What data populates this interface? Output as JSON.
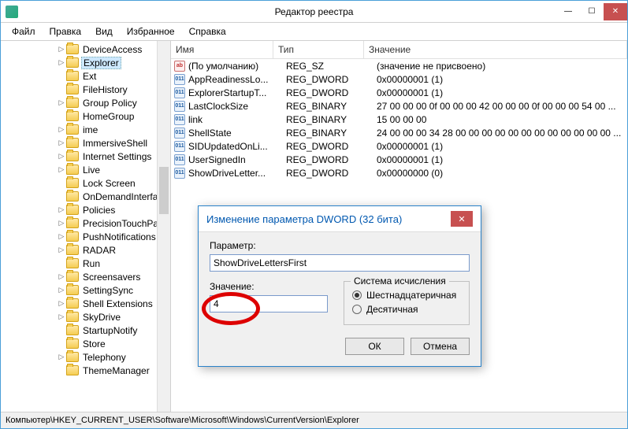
{
  "window": {
    "title": "Редактор реестра"
  },
  "menu": {
    "file": "Файл",
    "edit": "Правка",
    "view": "Вид",
    "favorites": "Избранное",
    "help": "Справка"
  },
  "tree": {
    "selected": "Explorer",
    "items": [
      {
        "label": "DeviceAccess",
        "exp": true
      },
      {
        "label": "Explorer",
        "exp": true,
        "selected": true
      },
      {
        "label": "Ext",
        "exp": false
      },
      {
        "label": "FileHistory",
        "exp": false
      },
      {
        "label": "Group Policy",
        "exp": true
      },
      {
        "label": "HomeGroup",
        "exp": false
      },
      {
        "label": "ime",
        "exp": true
      },
      {
        "label": "ImmersiveShell",
        "exp": true
      },
      {
        "label": "Internet Settings",
        "exp": true
      },
      {
        "label": "Live",
        "exp": true
      },
      {
        "label": "Lock Screen",
        "exp": false
      },
      {
        "label": "OnDemandInterfac",
        "exp": false
      },
      {
        "label": "Policies",
        "exp": true
      },
      {
        "label": "PrecisionTouchPa",
        "exp": true
      },
      {
        "label": "PushNotifications",
        "exp": true
      },
      {
        "label": "RADAR",
        "exp": true
      },
      {
        "label": "Run",
        "exp": false
      },
      {
        "label": "Screensavers",
        "exp": true
      },
      {
        "label": "SettingSync",
        "exp": true
      },
      {
        "label": "Shell Extensions",
        "exp": true
      },
      {
        "label": "SkyDrive",
        "exp": true
      },
      {
        "label": "StartupNotify",
        "exp": false
      },
      {
        "label": "Store",
        "exp": false
      },
      {
        "label": "Telephony",
        "exp": true
      },
      {
        "label": "ThemeManager",
        "exp": false
      }
    ]
  },
  "columns": {
    "name": "Имя",
    "type": "Тип",
    "value": "Значение"
  },
  "values": [
    {
      "icon": "str",
      "name": "(По умолчанию)",
      "type": "REG_SZ",
      "value": "(значение не присвоено)"
    },
    {
      "icon": "bin",
      "name": "AppReadinessLo...",
      "type": "REG_DWORD",
      "value": "0x00000001 (1)"
    },
    {
      "icon": "bin",
      "name": "ExplorerStartupT...",
      "type": "REG_DWORD",
      "value": "0x00000001 (1)"
    },
    {
      "icon": "bin",
      "name": "LastClockSize",
      "type": "REG_BINARY",
      "value": "27 00 00 00 0f 00 00 00 42 00 00 00 0f 00 00 00 54 00 ..."
    },
    {
      "icon": "bin",
      "name": "link",
      "type": "REG_BINARY",
      "value": "15 00 00 00"
    },
    {
      "icon": "bin",
      "name": "ShellState",
      "type": "REG_BINARY",
      "value": "24 00 00 00 34 28 00 00 00 00 00 00 00 00 00 00 00 00 ..."
    },
    {
      "icon": "bin",
      "name": "SIDUpdatedOnLi...",
      "type": "REG_DWORD",
      "value": "0x00000001 (1)"
    },
    {
      "icon": "bin",
      "name": "UserSignedIn",
      "type": "REG_DWORD",
      "value": "0x00000001 (1)"
    },
    {
      "icon": "bin",
      "name": "ShowDriveLetter...",
      "type": "REG_DWORD",
      "value": "0x00000000 (0)"
    }
  ],
  "statusbar": "Компьютер\\HKEY_CURRENT_USER\\Software\\Microsoft\\Windows\\CurrentVersion\\Explorer",
  "dialog": {
    "title": "Изменение параметра DWORD (32 бита)",
    "param_label": "Параметр:",
    "param_value": "ShowDriveLettersFirst",
    "value_label": "Значение:",
    "value_value": "4",
    "base_legend": "Система исчисления",
    "radio_hex": "Шестнадцатеричная",
    "radio_dec": "Десятичная",
    "radio_selected": "hex",
    "ok": "ОК",
    "cancel": "Отмена"
  }
}
